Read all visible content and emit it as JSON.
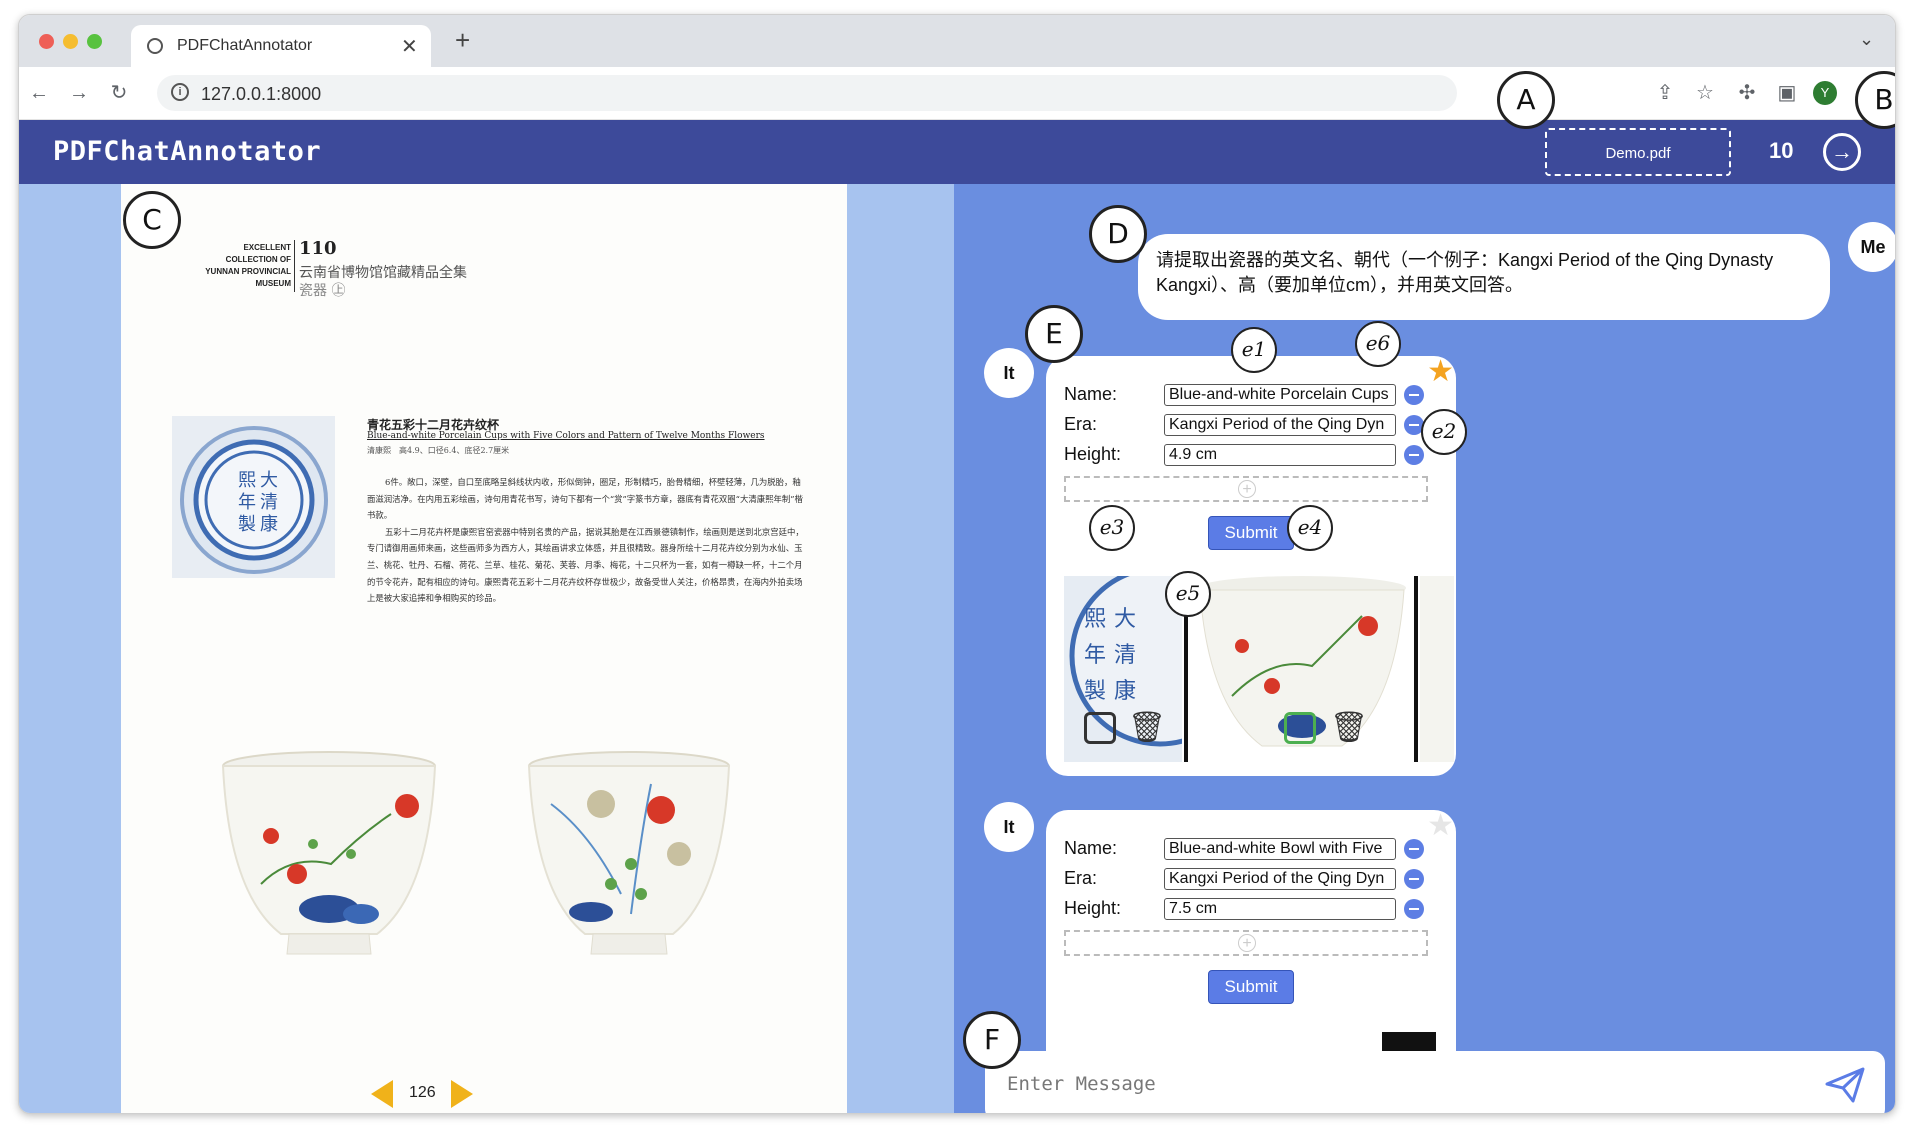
{
  "browser": {
    "tab_title": "PDFChatAnnotator",
    "url": "127.0.0.1:8000"
  },
  "app": {
    "title": "PDFChatAnnotator",
    "file_name": "Demo.pdf",
    "page_count": "10"
  },
  "pdf": {
    "collection_en": [
      "EXCELLENT",
      "COLLECTION OF",
      "YUNNAN PROVINCIAL",
      "MUSEUM"
    ],
    "page_header_number": "110",
    "collection_cn": "云南省博物馆馆藏精品全集",
    "category_cn": "瓷器 ㊤",
    "item_title_cn": "青花五彩十二月花卉纹杯",
    "item_title_en": "Blue-and-white Porcelain Cups with Five Colors and Pattern of Twelve Months Flowers",
    "item_meta": "清康熙　高4.9、口径6.4、底径2.7厘米",
    "body_paragraphs": [
      "6件。敞口，深壁，自口至底略呈斜线状内收，形似倒钟，圈足，形制精巧，胎骨精细，杯壁轻薄，几为脱胎，釉面滋润洁净。在内用五彩绘画，诗句用青花书写，诗句下都有一个“赏”字篆书方章，器底有青花双圈“大清康熙年制”楷书款。",
      "五彩十二月花卉杯是康熙官窑瓷器中特别名贵的产品，据说其胎是在江西景德镇制作，绘画则是送到北京宫廷中，专门请御用画师来画，这些画师多为西方人，其绘画讲求立体感，并且很精致。器身所绘十二月花卉纹分别为水仙、玉兰、桃花、牡丹、石榴、荷花、兰草、桂花、菊花、芙蓉、月季、梅花，十二只杯为一套，如有一樽缺一杯，十二个月的节令花卉，配有相应的诗句。康熙青花五彩十二月花卉纹杯存世极少，故备受世人关注，价格昂贵，在海内外拍卖场上是被大家追捧和争相购买的珍品。"
    ],
    "page_number": "126"
  },
  "chat": {
    "user_label": "Me",
    "ai_label": "It",
    "user_message": "请提取出瓷器的英文名、朝代（一个例子：Kangxi Period of the Qing Dynasty Kangxi）、高（要加单位cm），并用英文回答。",
    "cards": [
      {
        "fields": [
          {
            "label": "Name:",
            "value": "Blue-and-white Porcelain Cups"
          },
          {
            "label": "Era:",
            "value": "Kangxi Period of the Qing Dyn"
          },
          {
            "label": "Height:",
            "value": "4.9 cm"
          }
        ],
        "submit_label": "Submit",
        "starred": true
      },
      {
        "fields": [
          {
            "label": "Name:",
            "value": "Blue-and-white Bowl with Five"
          },
          {
            "label": "Era:",
            "value": "Kangxi Period of the Qing Dyn"
          },
          {
            "label": "Height:",
            "value": "7.5 cm"
          }
        ],
        "submit_label": "Submit",
        "starred": false
      }
    ],
    "message_placeholder": "Enter Message"
  },
  "annotations": {
    "A": "A",
    "B": "B",
    "C": "C",
    "D": "D",
    "E": "E",
    "F": "F",
    "e1": "e1",
    "e2": "e2",
    "e3": "e3",
    "e4": "e4",
    "e5": "e5",
    "e6": "e6"
  },
  "colors": {
    "app_bar": "#3d4a9a",
    "chat_bg": "#6a8ee0",
    "pdf_bg": "#a7c3ef",
    "accent": "#5b7ce6",
    "star": "#f4a321"
  }
}
